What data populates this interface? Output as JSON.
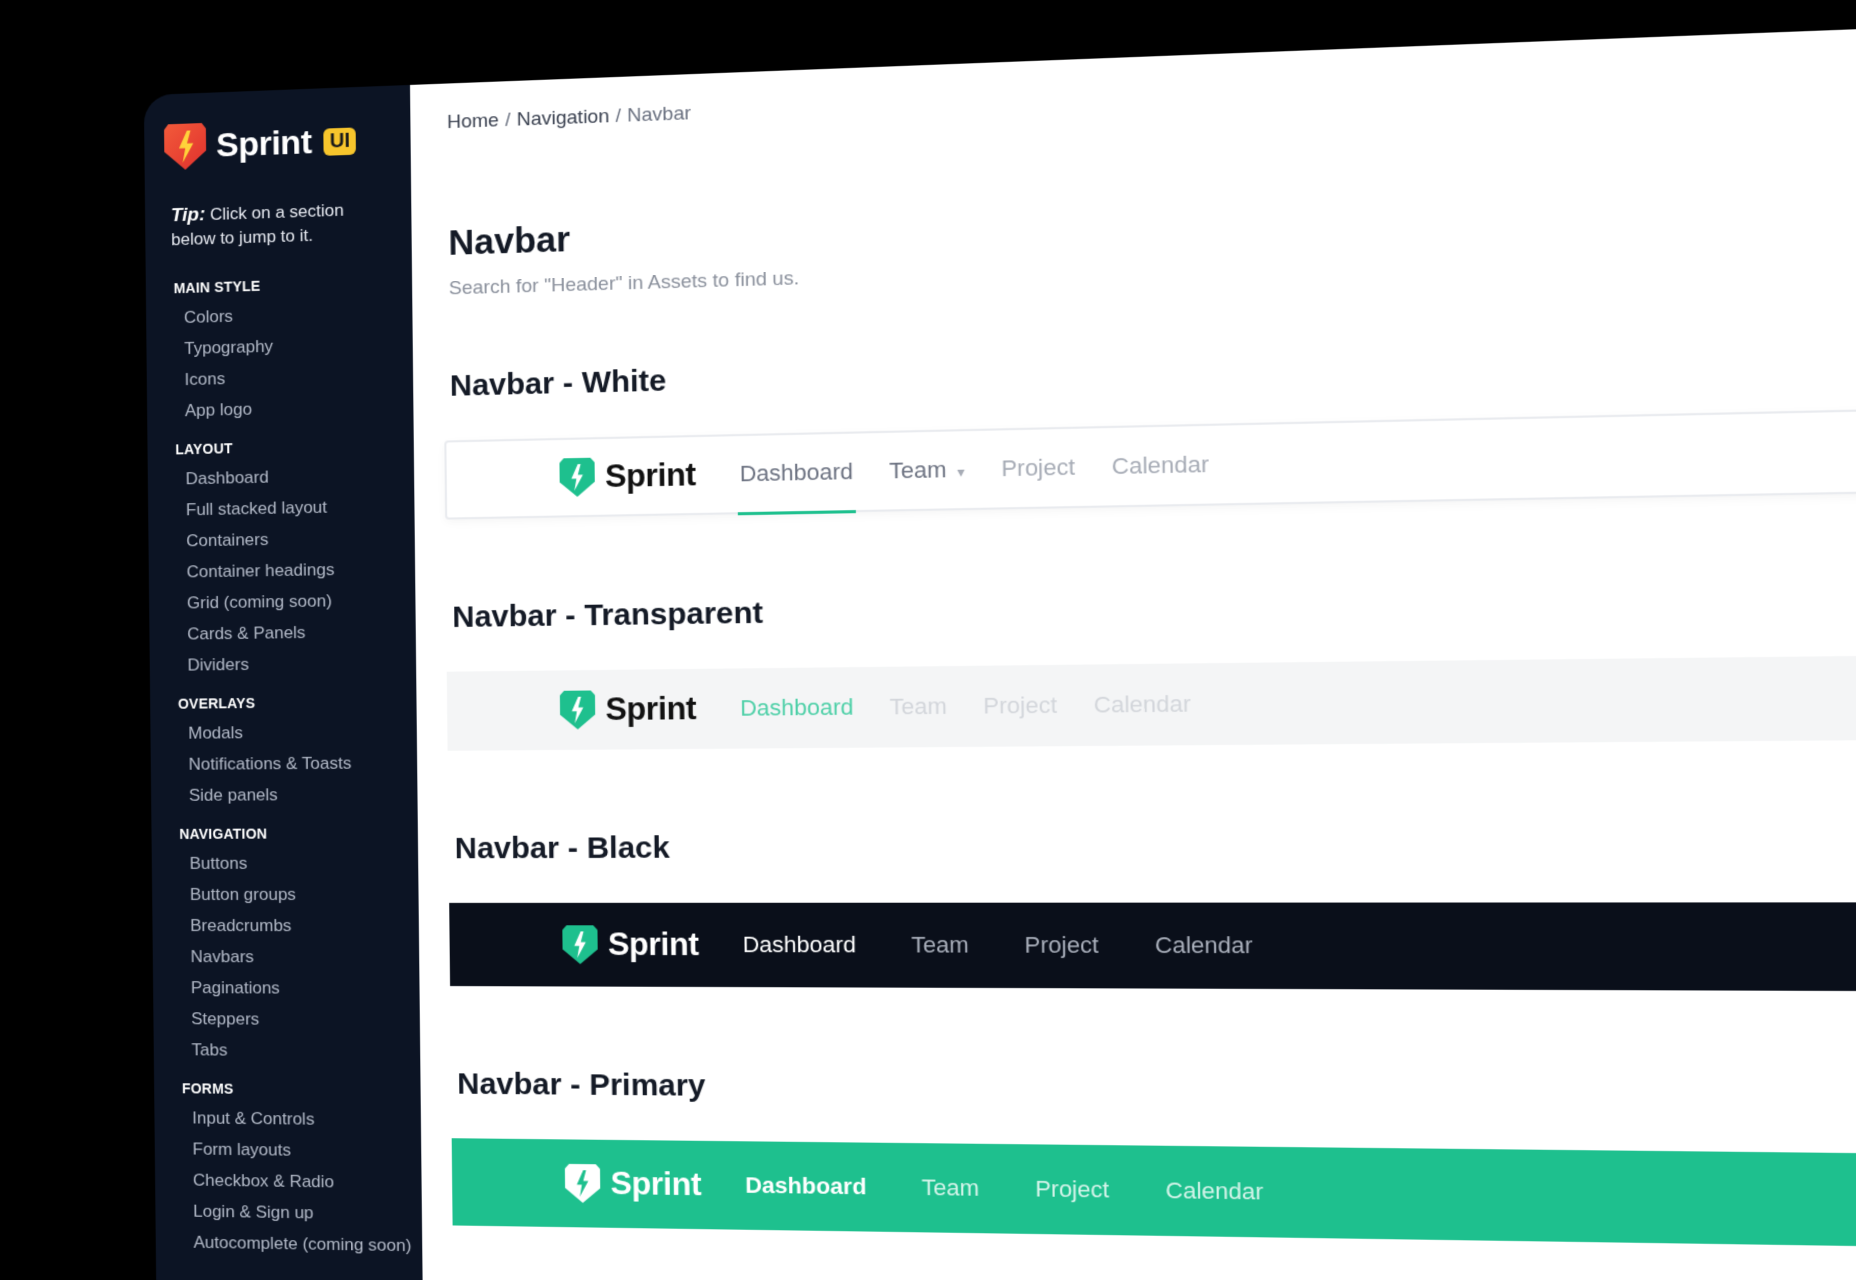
{
  "sidebar": {
    "brand_name": "Sprint",
    "brand_badge": "UI",
    "tip_label": "Tip:",
    "tip_text": "Click on a section below to jump to it.",
    "sections": [
      {
        "heading": "MAIN STYLE",
        "items": [
          "Colors",
          "Typography",
          "Icons",
          "App logo"
        ]
      },
      {
        "heading": "LAYOUT",
        "items": [
          "Dashboard",
          "Full stacked layout",
          "Containers",
          "Container headings",
          "Grid (coming soon)",
          "Cards & Panels",
          "Dividers"
        ]
      },
      {
        "heading": "OVERLAYS",
        "items": [
          "Modals",
          "Notifications & Toasts",
          "Side panels"
        ]
      },
      {
        "heading": "NAVIGATION",
        "items": [
          "Buttons",
          "Button groups",
          "Breadcrumbs",
          "Navbars",
          "Paginations",
          "Steppers",
          "Tabs"
        ]
      },
      {
        "heading": "FORMS",
        "items": [
          "Input & Controls",
          "Form layouts",
          "Checkbox & Radio",
          "Login & Sign up",
          "Autocomplete (coming soon)"
        ]
      }
    ]
  },
  "breadcrumb": {
    "home": "Home",
    "sep": "/",
    "navigation": "Navigation",
    "current": "Navbar"
  },
  "page": {
    "title": "Navbar",
    "subtitle": "Search for \"Header\" in Assets to find us."
  },
  "demos": {
    "logo_text": "Sprint",
    "white": {
      "title": "Navbar - White",
      "links": [
        "Dashboard",
        "Team",
        "Project",
        "Calendar"
      ]
    },
    "transparent": {
      "title": "Navbar - Transparent",
      "links": [
        "Dashboard",
        "Team",
        "Project",
        "Calendar"
      ]
    },
    "black": {
      "title": "Navbar - Black",
      "links": [
        "Dashboard",
        "Team",
        "Project",
        "Calendar"
      ]
    },
    "primary": {
      "title": "Navbar - Primary",
      "links": [
        "Dashboard",
        "Team",
        "Project",
        "Calendar"
      ]
    }
  },
  "colors": {
    "sidebar_bg": "#0c1424",
    "primary": "#1ec08e",
    "brand_red": "#e0312d",
    "badge_yellow": "#f7c52c",
    "black_nav": "#0a0f1a"
  },
  "icons": {
    "brand": "lightning-shield-icon",
    "dropdown": "chevron-down-icon"
  }
}
